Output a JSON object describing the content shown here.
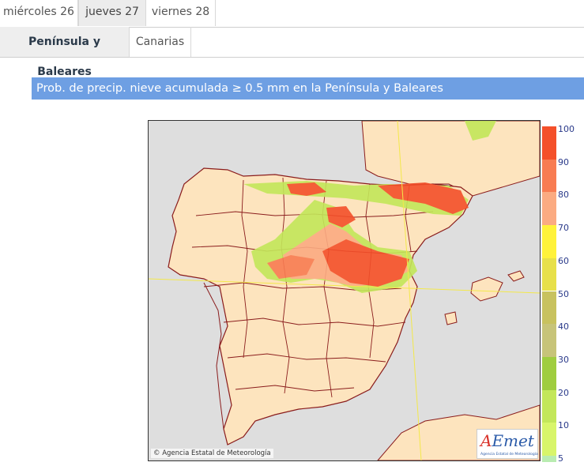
{
  "day_tabs": [
    "miércoles 26",
    "jueves 27",
    "viernes 28"
  ],
  "region_tabs": [
    "Península y Baleares",
    "Canarias"
  ],
  "map_title": "Prob. de precip. nieve acumulada ≥ 0.5 mm en la Península y Baleares",
  "credit": "Agencia Estatal de Meteorología",
  "logo": {
    "text_a": "A",
    "text_b": "Emet",
    "sub": "Agencia Estatal de Meteorología"
  },
  "legend": {
    "labels": [
      "100",
      "90",
      "80",
      "70",
      "60",
      "50",
      "40",
      "30",
      "20",
      "10",
      "5"
    ],
    "colors": [
      "#f4502a",
      "#f87c52",
      "#fbab82",
      "#fff23a",
      "#e7e04a",
      "#c8c25f",
      "#c7c479",
      "#9fcd3f",
      "#c3e75a",
      "#d8f56a",
      "#b9ecb1"
    ]
  },
  "colors": {
    "land": "#fde4be",
    "sea": "#dedede",
    "border": "#8a1c1c",
    "title_bar": "#6e9fe3"
  }
}
